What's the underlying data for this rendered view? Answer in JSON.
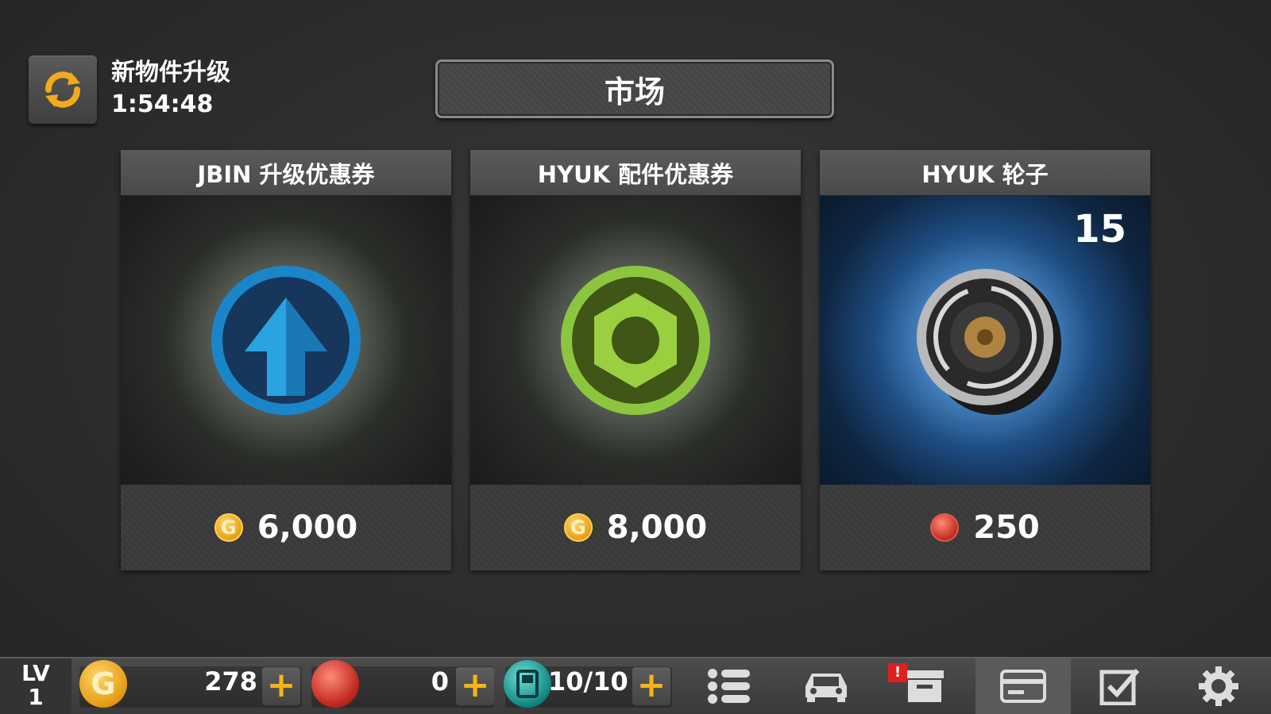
{
  "refresh": {
    "label": "新物件升级",
    "timer": "1:54:48"
  },
  "title": "市场",
  "items": [
    {
      "name": "JBIN 升级优惠券",
      "price": "6,000",
      "currency": "gold",
      "icon": "upgrade-arrow-icon"
    },
    {
      "name": "HYUK 配件优惠券",
      "price": "8,000",
      "currency": "gold",
      "icon": "hex-nut-icon"
    },
    {
      "name": "HYUK 轮子",
      "price": "250",
      "currency": "gem",
      "count": "15",
      "icon": "wheel-icon"
    }
  ],
  "bottom": {
    "lv_label": "LV",
    "lv_value": "1",
    "gold": "278",
    "gems": "0",
    "fuel": "10/10",
    "alert_badge": "!"
  },
  "colors": {
    "gold": "#f4b41a",
    "accent_blue": "#1f7fc4",
    "accent_green": "#8cc63f"
  }
}
